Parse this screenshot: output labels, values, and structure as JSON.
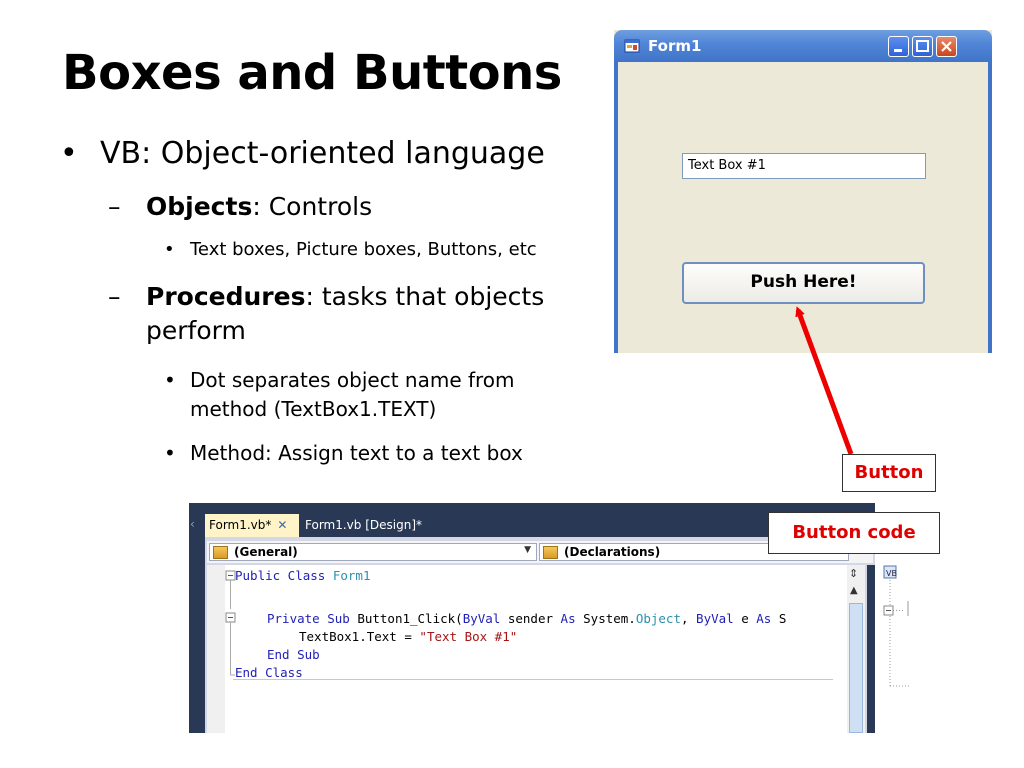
{
  "slide": {
    "title": "Boxes and Buttons",
    "bullets": {
      "b1": "VB:  Object-oriented language",
      "b2_bold": "Objects",
      "b2_rest": ": Controls",
      "b3": "Text boxes, Picture boxes, Buttons, etc",
      "b4_bold": "Procedures",
      "b4_rest": ": tasks that objects perform",
      "b5": "Dot separates object name from method (TextBox1.TEXT)",
      "b6": "Method: Assign text to a text box"
    },
    "markers": {
      "bullet": "•",
      "dash": "–"
    }
  },
  "form_window": {
    "title": "Form1",
    "textbox_value": "Text Box #1",
    "button_label": "Push Here!"
  },
  "labels": {
    "button": "Button",
    "button_code": "Button code"
  },
  "ide": {
    "tabs": [
      "Form1.vb*",
      "Form1.vb [Design]*"
    ],
    "tab_close": "✕",
    "dropdown_left": "(General)",
    "dropdown_right": "(Declarations)",
    "code": {
      "l1_kw": "Public Class",
      "l1_type": "Form1",
      "l3_kw1": "Private Sub",
      "l3_name": "Button1_Click(",
      "l3_kw2": "ByVal",
      "l3_mid": "sender",
      "l3_kw3": "As",
      "l3_sys": "System.",
      "l3_type": "Object",
      "l3_sep": ", ",
      "l3_kw4": "ByVal",
      "l3_e": "e",
      "l3_kw5": "As",
      "l3_tail": "S",
      "l4_code": "TextBox1.Text = ",
      "l4_str": "\"Text Box #1\"",
      "l5_kw": "End Sub",
      "l6_kw": "End Class"
    }
  },
  "colors": {
    "accent_red": "#e00000",
    "xp_blue": "#3f74c8",
    "ide_dark": "#293955"
  }
}
